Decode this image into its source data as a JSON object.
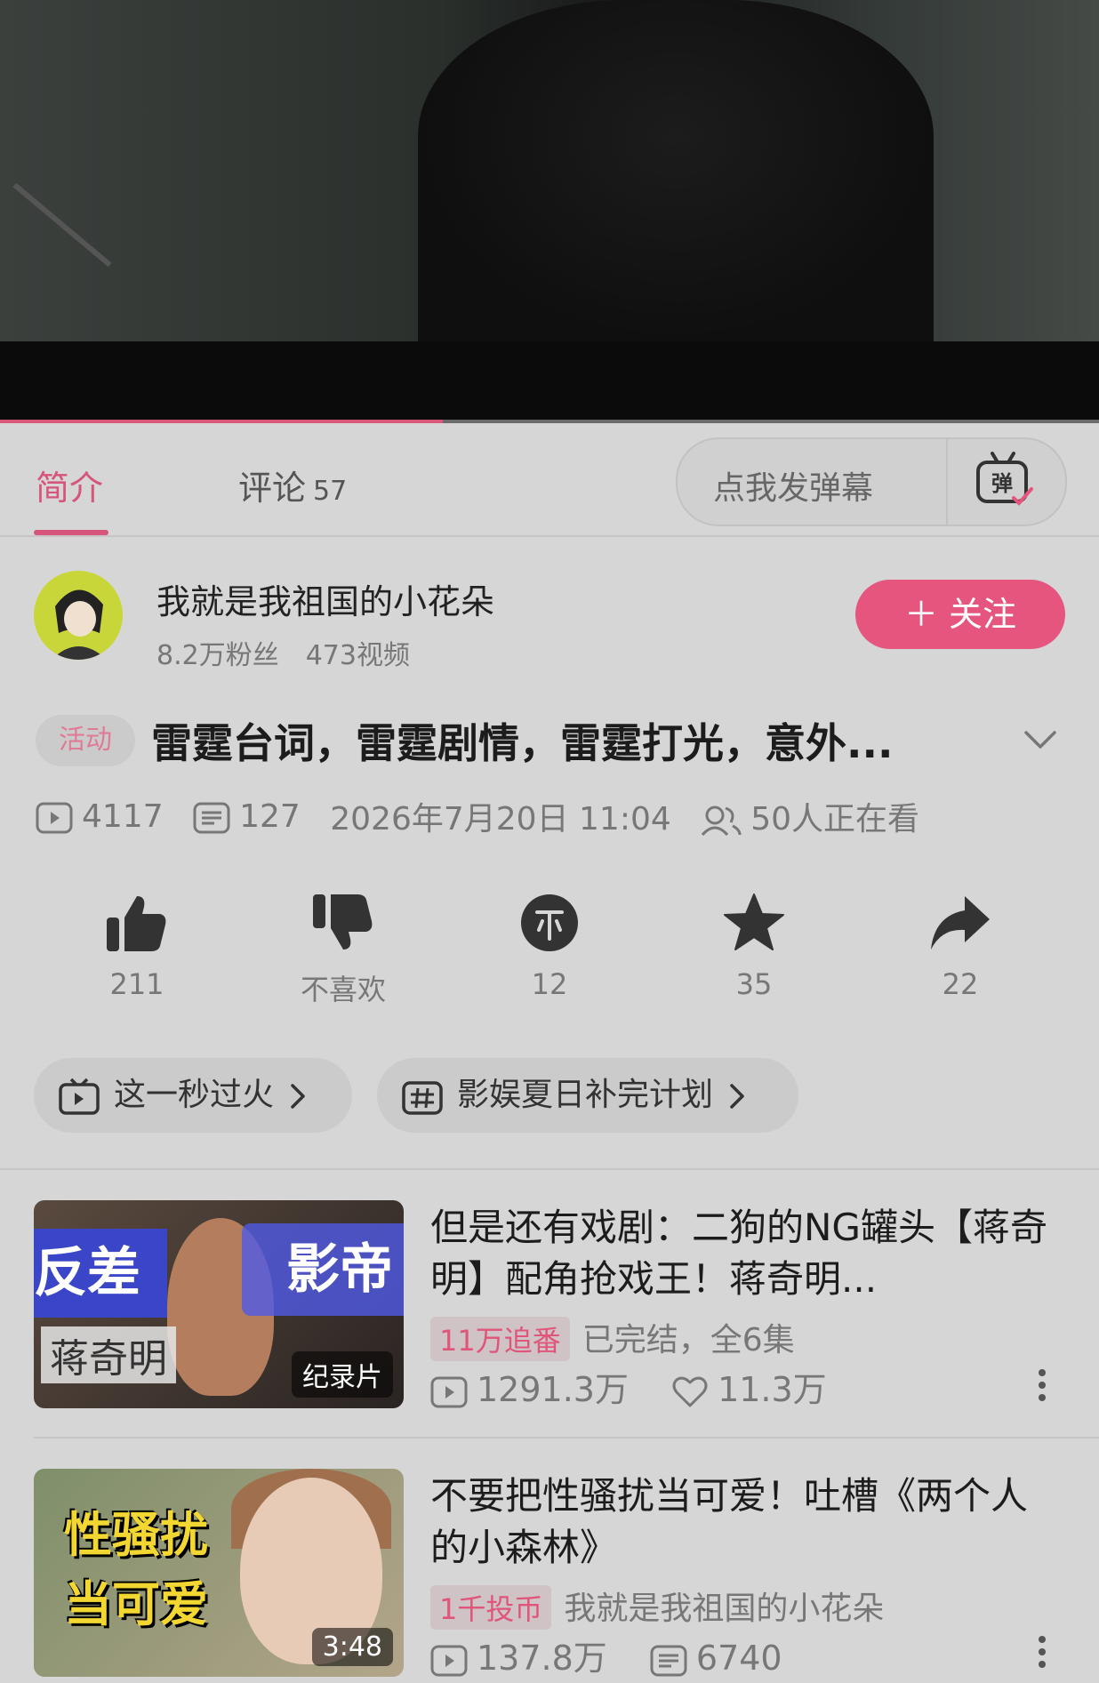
{
  "player": {
    "progress": 0.403
  },
  "tabs": {
    "intro": "简介",
    "comments": "评论",
    "comment_count": "57"
  },
  "danmaku": {
    "placeholder": "点我发弹幕",
    "icon_char": "弹"
  },
  "uploader": {
    "name": "我就是我祖国的小花朵",
    "fans": "8.2万粉丝",
    "videos": "473视频",
    "follow_label": "＋ 关注"
  },
  "video": {
    "badge": "活动",
    "title": "雷霆台词，雷霆剧情，雷霆打光，意外...",
    "views": "4117",
    "danmaku_count": "127",
    "date": "2026年7月20日 11:04",
    "watching": "50人正在看"
  },
  "actions": {
    "like": "211",
    "dislike": "不喜欢",
    "coin": "12",
    "favorite": "35",
    "share": "22"
  },
  "chips": [
    {
      "label": "这一秒过火"
    },
    {
      "label": "影娱夏日补完计划"
    }
  ],
  "recommendations": [
    {
      "title": "但是还有戏剧：二狗的NG罐头【蒋奇明】配角抢戏王！蒋奇明...",
      "thumb_left": "反差",
      "thumb_right": "影帝",
      "thumb_name": "蒋奇明",
      "thumb_tag": "纪录片",
      "badge": "11万追番",
      "info": "已完结，全6集",
      "stat1": "1291.3万",
      "stat2": "11.3万"
    },
    {
      "title": "不要把性骚扰当可爱！吐槽《两个人的小森林》",
      "thumb_line1": "性骚扰",
      "thumb_line2": "当可爱",
      "thumb_tag": "3:48",
      "badge": "1千投币",
      "info": "我就是我祖国的小花朵",
      "stat1": "137.8万",
      "stat2": "6740"
    }
  ],
  "colors": {
    "accent": "#e5557d",
    "background": "#d6d6d6"
  }
}
